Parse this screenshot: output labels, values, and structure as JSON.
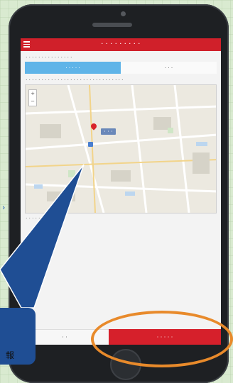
{
  "app": {
    "title": "・・・・・・・・・",
    "section_label": "・・・・・・・・・・・・・・・",
    "tabs": [
      "・・・・・",
      "・・・"
    ],
    "map_instruction": "・・・・・・・・・・・・・・・・・・・・・・・・・・・・・・・",
    "pin_label": "・・・",
    "map_hint": "・・・・・・・・・・・・",
    "footer": {
      "back_label": "・・",
      "next_label": "・・・・・"
    },
    "zoom_plus": "+",
    "zoom_minus": "−"
  },
  "overlay": {
    "callout_text": "報",
    "colors": {
      "callout": "#1f4e94",
      "ring": "#e88a2b",
      "brand_red": "#d0202a",
      "tab_blue": "#5fb4e8"
    }
  }
}
